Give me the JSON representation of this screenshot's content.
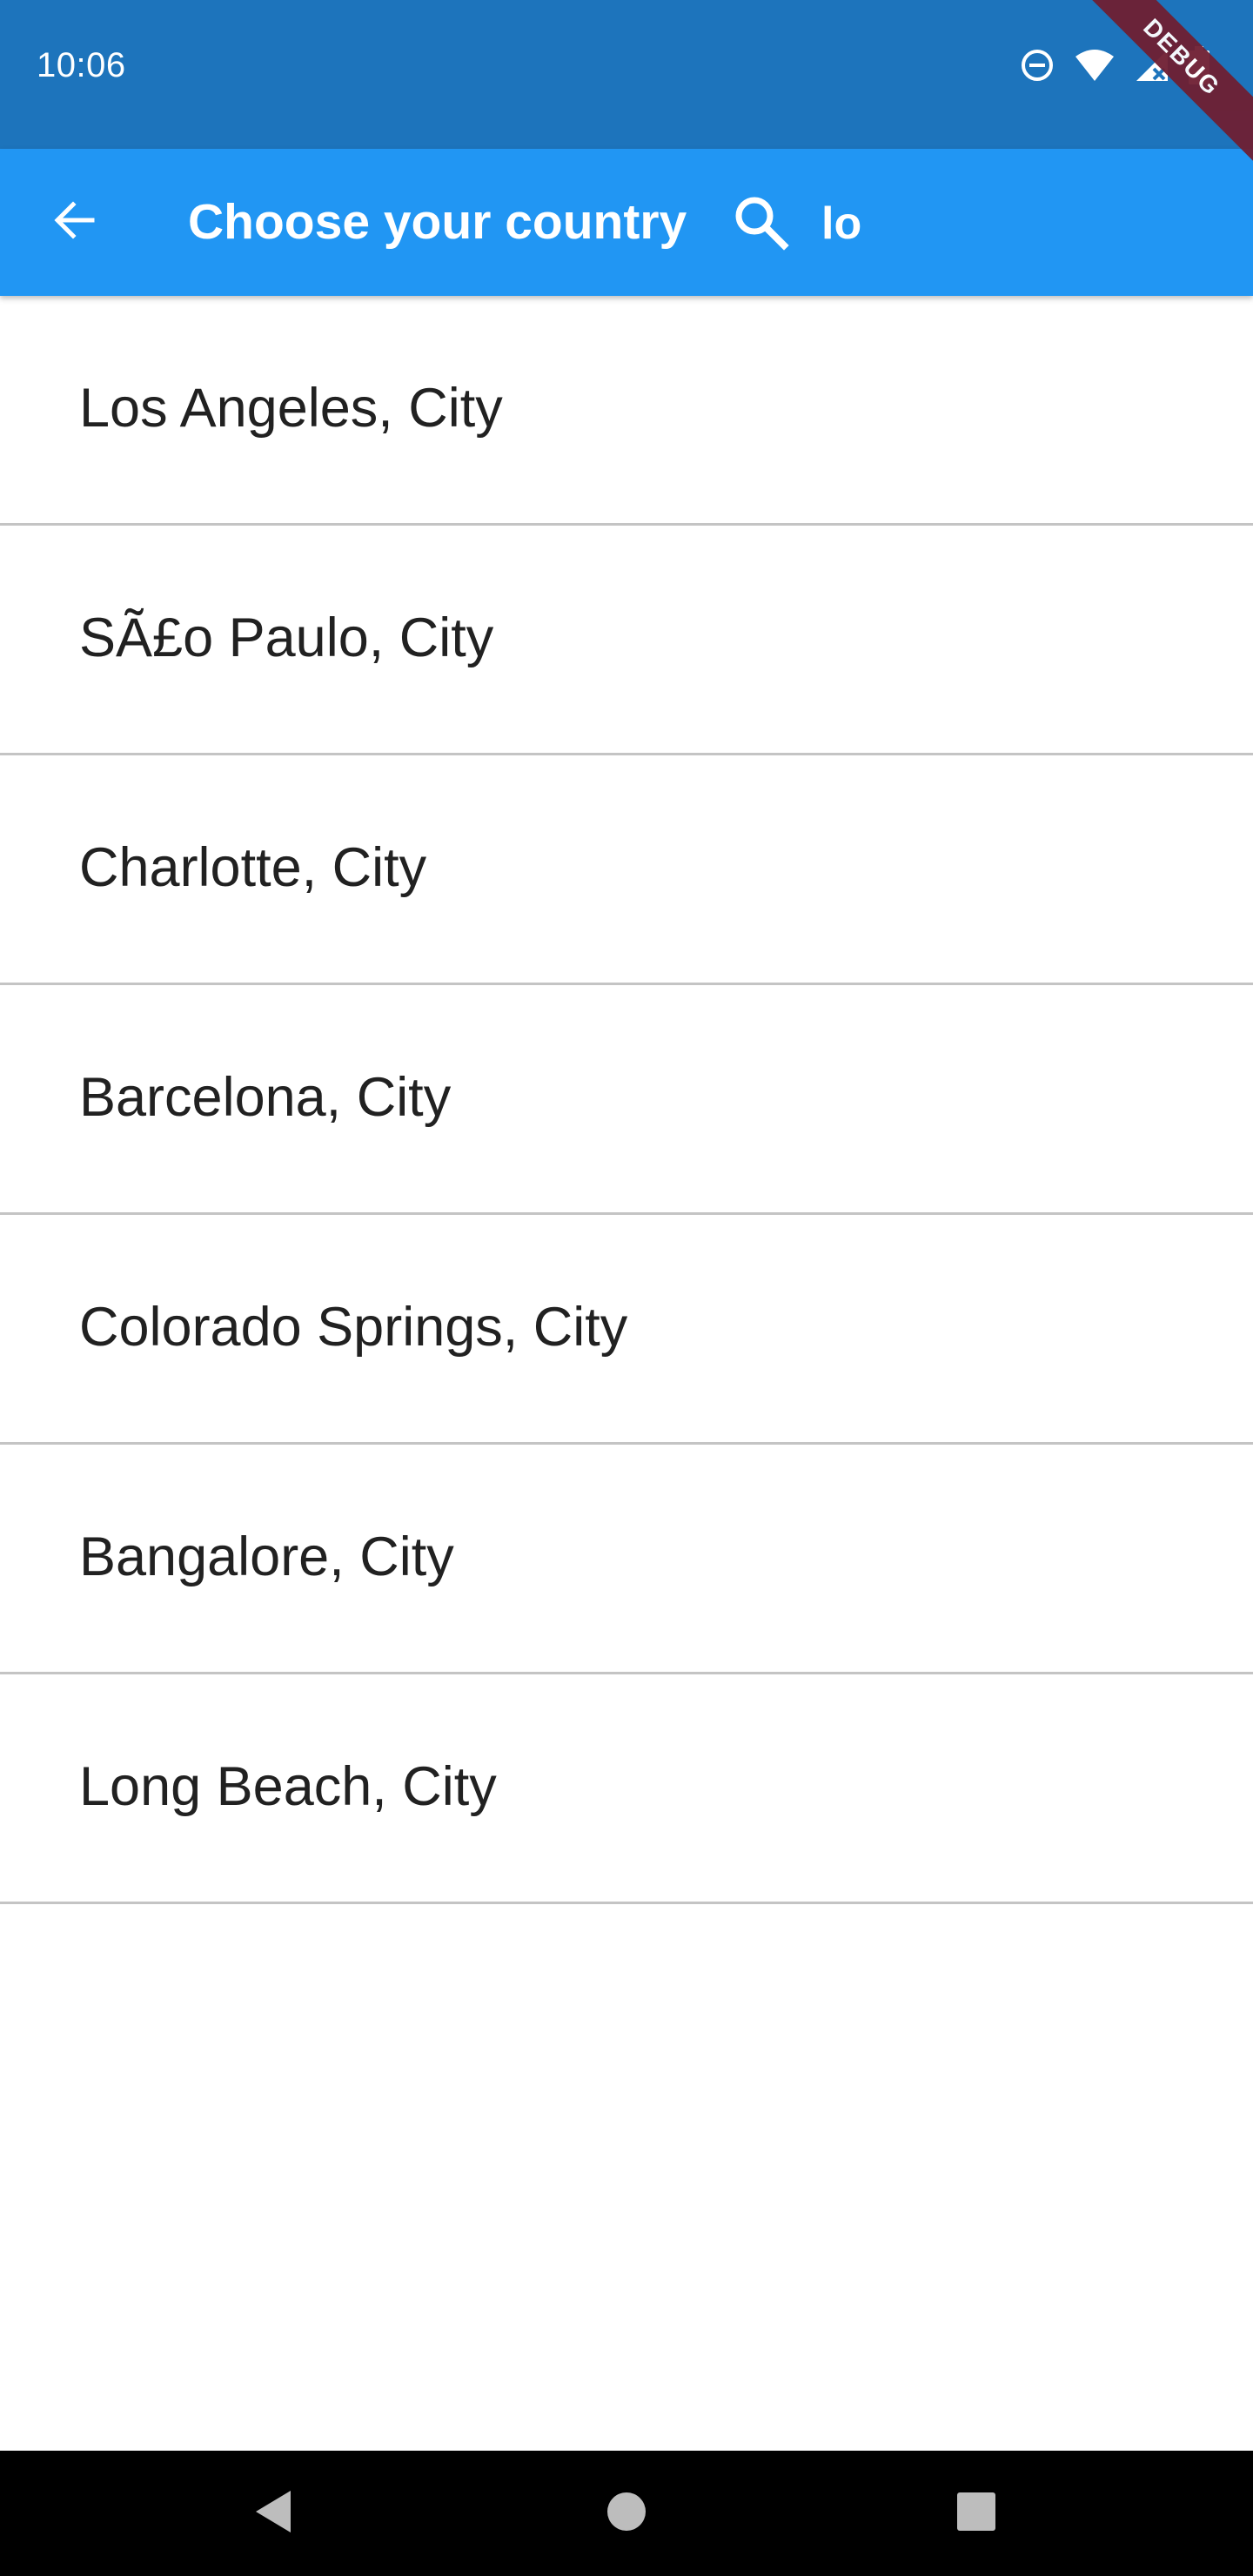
{
  "status_bar": {
    "time": "10:06",
    "icons": [
      "do-not-disturb-icon",
      "wifi-icon",
      "signal-icon",
      "battery-icon"
    ],
    "background": "#1d74bc"
  },
  "debug_banner": {
    "label": "DEBUG",
    "color": "#6f1f33"
  },
  "app_bar": {
    "title": "Choose your country",
    "back_icon": "arrow-back-icon",
    "search_icon": "search-icon",
    "search_value": "lo",
    "background": "#2196f3"
  },
  "cities": [
    {
      "label": "Los Angeles, City"
    },
    {
      "label": "SÃ£o Paulo, City"
    },
    {
      "label": "Charlotte, City"
    },
    {
      "label": "Barcelona, City"
    },
    {
      "label": "Colorado Springs, City"
    },
    {
      "label": "Bangalore, City"
    },
    {
      "label": "Long Beach, City"
    }
  ],
  "nav_bar": {
    "icons": [
      "back-triangle-icon",
      "home-circle-icon",
      "recents-square-icon"
    ]
  }
}
